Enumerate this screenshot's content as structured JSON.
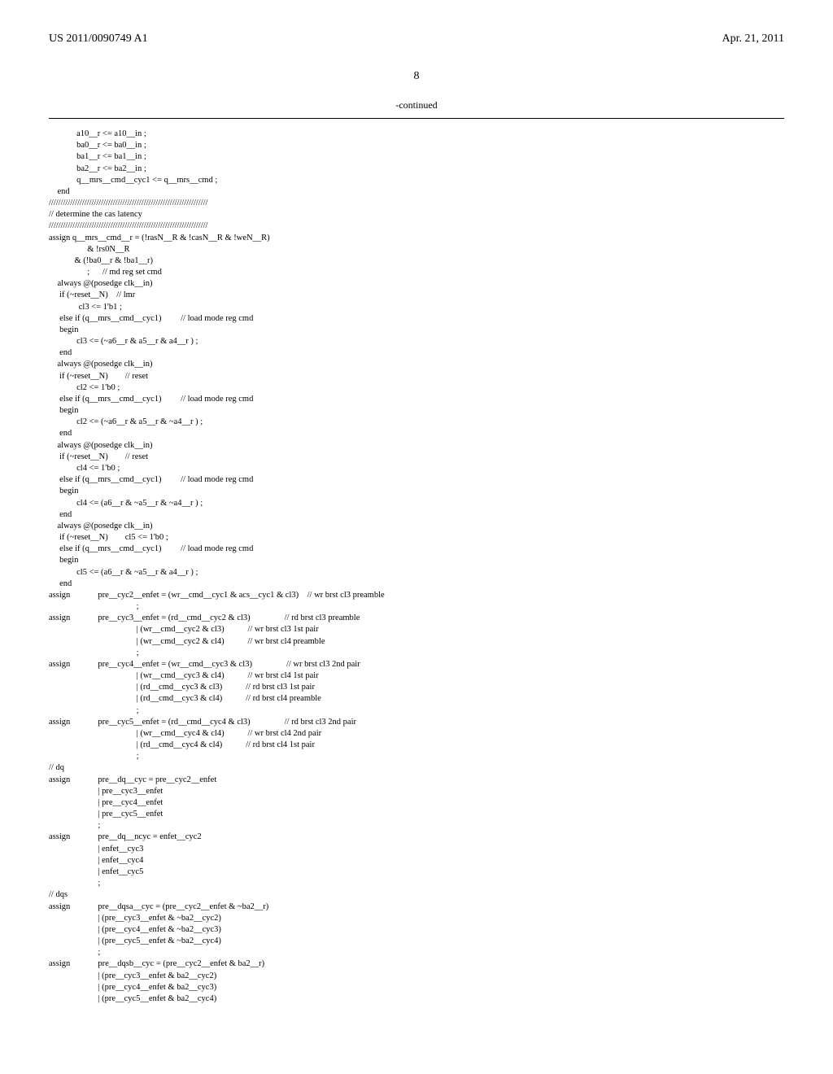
{
  "header": {
    "left": "US 2011/0090749 A1",
    "right": "Apr. 21, 2011"
  },
  "page_number": "8",
  "continued": "-continued",
  "code": "             a10__r <= a10__in ;\n             ba0__r <= ba0__in ;\n             ba1__r <= ba1__in ;\n             ba2__r <= ba2__in ;\n             q__mrs__cmd__cyc1 <= q__mrs__cmd ;\n    end\n///////////////////////////////////////////////////////////////////\n// determine the cas latency\n///////////////////////////////////////////////////////////////////\nassign q__mrs__cmd__r = (!rasN__R & !casN__R & !weN__R)\n                  & !rs0N__R\n            & (!ba0__r & !ba1__r)\n                  ;      // md reg set cmd\n    always @(posedge clk__in)\n     if (~reset__N)    // lmr\n              cl3 <= 1'b1 ;\n     else if (q__mrs__cmd__cyc1)         // load mode reg cmd\n     begin\n             cl3 <= (~a6__r & a5__r & a4__r ) ;\n     end\n    always @(posedge clk__in)\n     if (~reset__N)        // reset\n             cl2 <= 1'b0 ;\n     else if (q__mrs__cmd__cyc1)         // load mode reg cmd\n     begin\n             cl2 <= (~a6__r & a5__r & ~a4__r ) ;\n     end\n    always @(posedge clk__in)\n     if (~reset__N)        // reset\n             cl4 <= 1'b0 ;\n     else if (q__mrs__cmd__cyc1)         // load mode reg cmd\n     begin\n             cl4 <= (a6__r & ~a5__r & ~a4__r ) ;\n     end\n    always @(posedge clk__in)\n     if (~reset__N)        cl5 <= 1'b0 ;\n     else if (q__mrs__cmd__cyc1)         // load mode reg cmd\n     begin\n             cl5 <= (a6__r & ~a5__r & a4__r ) ;\n     end\nassign             pre__cyc2__enfet = (wr__cmd__cyc1 & acs__cyc1 & cl3)    // wr brst cl3 preamble\n                                         ;\nassign             pre__cyc3__enfet = (rd__cmd__cyc2 & cl3)                // rd brst cl3 preamble\n                                         | (wr__cmd__cyc2 & cl3)           // wr brst cl3 1st pair\n                                         | (wr__cmd__cyc2 & cl4)           // wr brst cl4 preamble\n                                         ;\nassign             pre__cyc4__enfet = (wr__cmd__cyc3 & cl3)                // wr brst cl3 2nd pair\n                                         | (wr__cmd__cyc3 & cl4)           // wr brst cl4 1st pair\n                                         | (rd__cmd__cyc3 & cl3)           // rd brst cl3 1st pair\n                                         | (rd__cmd__cyc3 & cl4)           // rd brst cl4 preamble\n                                         ;\nassign             pre__cyc5__enfet = (rd__cmd__cyc4 & cl3)                // rd brst cl3 2nd pair\n                                         | (wr__cmd__cyc4 & cl4)           // wr brst cl4 2nd pair\n                                         | (rd__cmd__cyc4 & cl4)           // rd brst cl4 1st pair\n                                         ;\n// dq\nassign             pre__dq__cyc = pre__cyc2__enfet\n                       | pre__cyc3__enfet\n                       | pre__cyc4__enfet\n                       | pre__cyc5__enfet\n                       ;\nassign             pre__dq__ncyc = enfet__cyc2\n                       | enfet__cyc3\n                       | enfet__cyc4\n                       | enfet__cyc5\n                       ;\n// dqs\nassign             pre__dqsa__cyc = (pre__cyc2__enfet & ~ba2__r)\n                       | (pre__cyc3__enfet & ~ba2__cyc2)\n                       | (pre__cyc4__enfet & ~ba2__cyc3)\n                       | (pre__cyc5__enfet & ~ba2__cyc4)\n                       ;\nassign             pre__dqsb__cyc = (pre__cyc2__enfet & ba2__r)\n                       | (pre__cyc3__enfet & ba2__cyc2)\n                       | (pre__cyc4__enfet & ba2__cyc3)\n                       | (pre__cyc5__enfet & ba2__cyc4)"
}
